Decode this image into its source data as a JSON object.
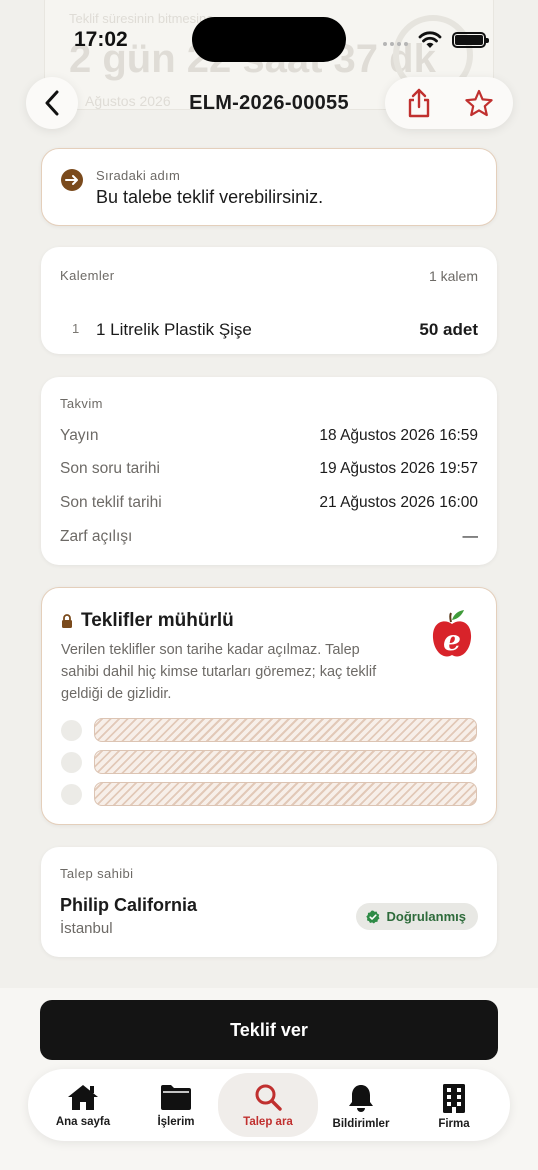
{
  "background_card": {
    "label": "Teklif süresinin bitmesine",
    "countdown": "2 gün 22 saat 37 dk",
    "date": "Ağustos 2026"
  },
  "status_bar": {
    "time": "17:02"
  },
  "nav": {
    "back_icon": "chevron-left-icon",
    "title": "ELM-2026-00055",
    "share_icon": "share-icon",
    "favorite_icon": "star-icon"
  },
  "next_step": {
    "label": "Sıradaki adım",
    "text": "Bu talebe teklif verebilirsiniz."
  },
  "items": {
    "label": "Kalemler",
    "count": "1 kalem",
    "rows": [
      {
        "num": "1",
        "name": "1 Litrelik Plastik Şişe",
        "qty": "50 adet"
      }
    ]
  },
  "calendar": {
    "label": "Takvim",
    "rows": [
      {
        "key": "Yayın",
        "value": "18 Ağustos 2026 16:59"
      },
      {
        "key": "Son soru tarihi",
        "value": "19 Ağustos 2026 19:57"
      },
      {
        "key": "Son teklif tarihi",
        "value": "21 Ağustos 2026 16:00"
      },
      {
        "key": "Zarf açılışı",
        "value": "—"
      }
    ]
  },
  "sealed": {
    "title": "Teklifler mühürlü",
    "description": "Verilen teklifler son tarihe kadar açılmaz. Talep sahibi dahil hiç kimse tutarları göremez; kaç teklif geldiği de gizlidir.",
    "logo_letter": "e",
    "placeholder_rows": 3
  },
  "owner": {
    "label": "Talep sahibi",
    "name": "Philip California",
    "city": "İstanbul",
    "badge": "Doğrulanmış"
  },
  "primary_action": {
    "label": "Teklif ver"
  },
  "tabs": [
    {
      "label": "Ana sayfa",
      "icon": "home-icon",
      "active": false
    },
    {
      "label": "İşlerim",
      "icon": "folder-icon",
      "active": false
    },
    {
      "label": "Talep ara",
      "icon": "search-icon",
      "active": true
    },
    {
      "label": "Bildirimler",
      "icon": "bell-icon",
      "active": false
    },
    {
      "label": "Firma",
      "icon": "building-icon",
      "active": false
    }
  ],
  "colors": {
    "accent_red": "#c0302f",
    "next_step_brown": "#7a4a1c",
    "verified_green": "#2e6b3b",
    "primary_button": "#141414"
  }
}
